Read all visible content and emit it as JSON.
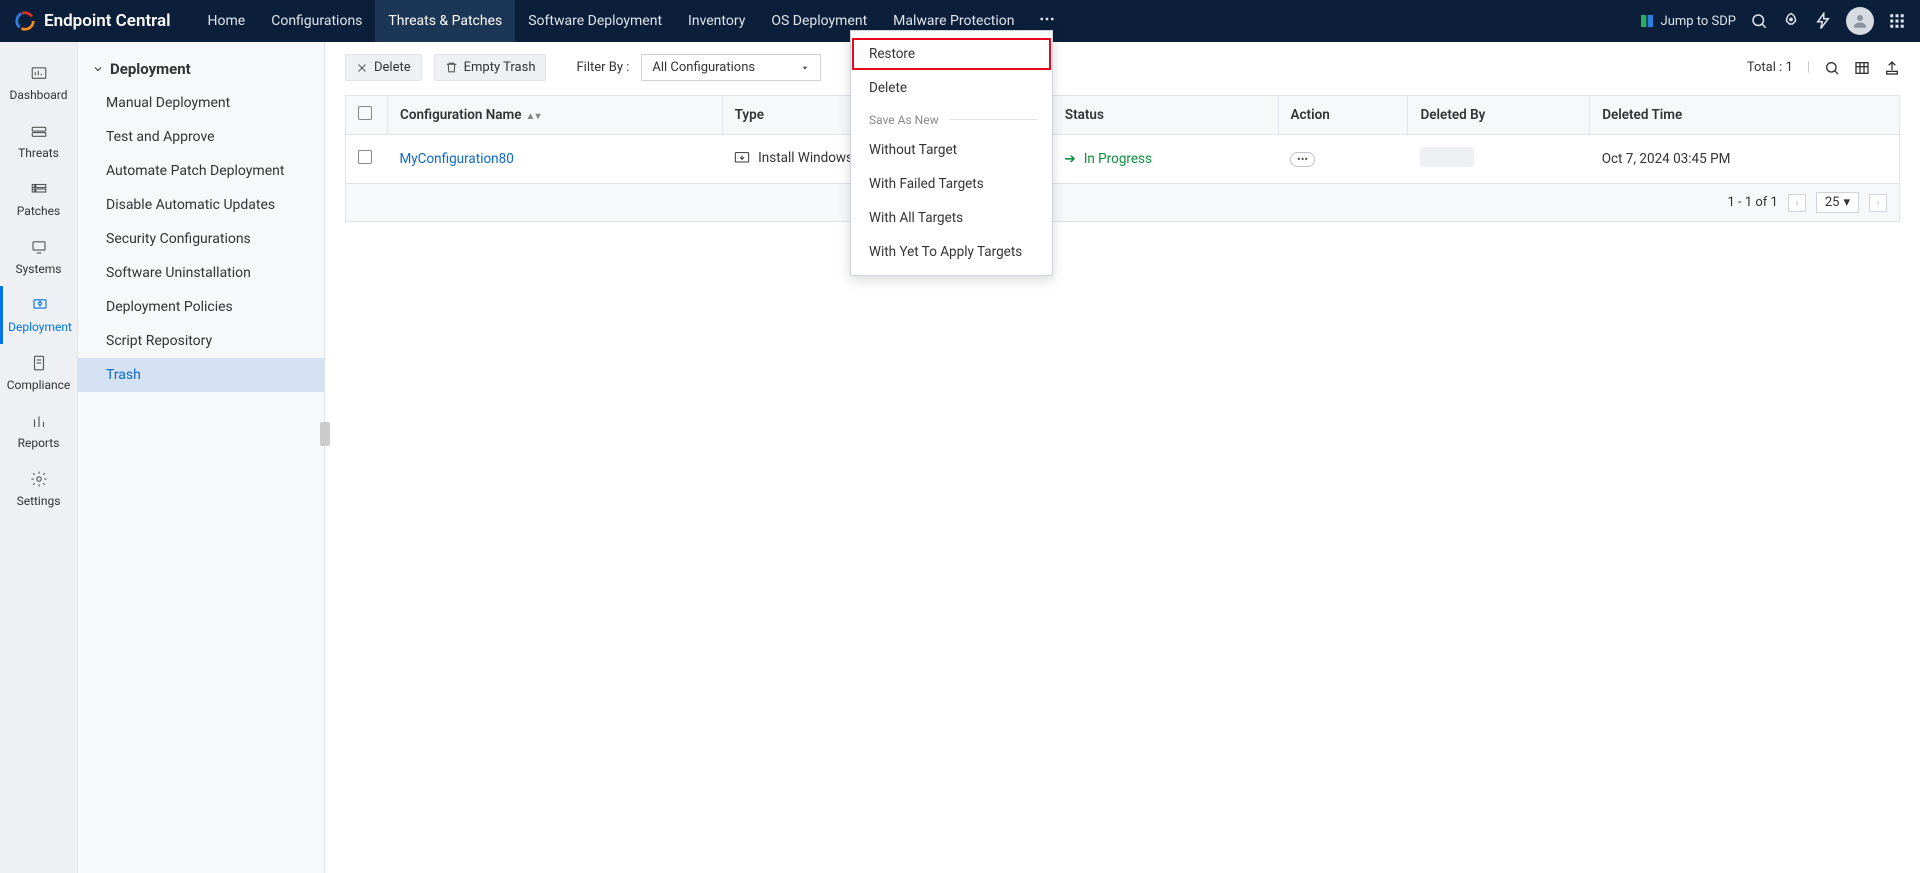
{
  "brand": "Endpoint Central",
  "nav": {
    "items": [
      "Home",
      "Configurations",
      "Threats & Patches",
      "Software Deployment",
      "Inventory",
      "OS Deployment",
      "Malware Protection"
    ],
    "jump": "Jump to SDP"
  },
  "rail": {
    "items": [
      "Dashboard",
      "Threats",
      "Patches",
      "Systems",
      "Deployment",
      "Compliance",
      "Reports",
      "Settings"
    ]
  },
  "sidebar": {
    "section": "Deployment",
    "items": [
      "Manual Deployment",
      "Test and Approve",
      "Automate Patch Deployment",
      "Disable Automatic Updates",
      "Security Configurations",
      "Software Uninstallation",
      "Deployment Policies",
      "Script Repository",
      "Trash"
    ]
  },
  "toolbar": {
    "delete": "Delete",
    "empty_trash": "Empty Trash",
    "filter_label": "Filter By :",
    "filter_value": "All Configurations",
    "total_label": "Total :",
    "total_value": "1"
  },
  "table": {
    "columns": [
      "",
      "Configuration Name",
      "Type",
      "Status",
      "Action",
      "Deleted By",
      "Deleted Time"
    ],
    "rows": [
      {
        "name": "MyConfiguration80",
        "type": "Install Windows P...",
        "status": "In Progress",
        "deleted_time": "Oct 7, 2024 03:45 PM"
      }
    ]
  },
  "pager": {
    "range": "1 - 1 of 1",
    "pagesize": "25"
  },
  "context_menu": {
    "restore": "Restore",
    "delete": "Delete",
    "group": "Save As New",
    "without_target": "Without Target",
    "with_failed": "With Failed Targets",
    "with_all": "With All Targets",
    "with_yet": "With Yet To Apply Targets"
  }
}
